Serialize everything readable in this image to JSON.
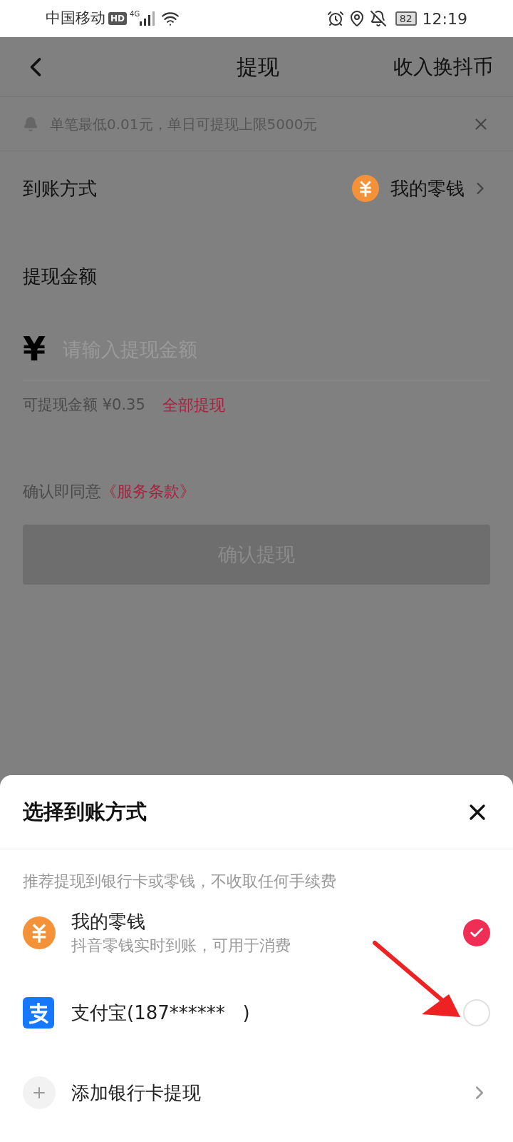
{
  "status_bar": {
    "carrier": "中国移动",
    "hd": "HD",
    "network": "4G",
    "battery": "82",
    "time": "12:19"
  },
  "header": {
    "title": "提现",
    "action": "收入换抖币"
  },
  "notice": {
    "text": "单笔最低0.01元，单日可提现上限5000元"
  },
  "payout_method": {
    "label": "到账方式",
    "value": "我的零钱"
  },
  "amount": {
    "label": "提现金额",
    "currency": "¥",
    "placeholder": "请输入提现金额",
    "available": "可提现金额 ¥0.35",
    "withdraw_all": "全部提现"
  },
  "agreement": {
    "text": "确认即同意",
    "link": "《服务条款》"
  },
  "confirm_button": {
    "label": "确认提现",
    "disabled": true
  },
  "sheet": {
    "title": "选择到账方式",
    "hint": "推荐提现到银行卡或零钱，不收取任何手续费",
    "items": [
      {
        "kind": "wallet",
        "title": "我的零钱",
        "subtitle": "抖音零钱实时到账，可用于消费",
        "selected": true
      },
      {
        "kind": "alipay",
        "title": "支付宝(187******   )",
        "selected": false
      },
      {
        "kind": "add",
        "title": "添加银行卡提现"
      }
    ]
  }
}
